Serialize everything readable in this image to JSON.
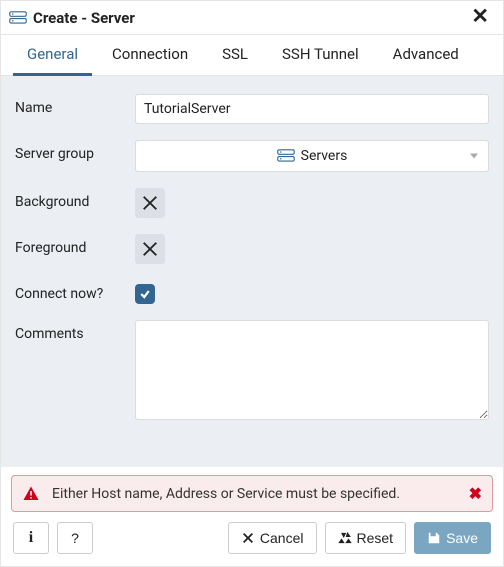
{
  "modal": {
    "title": "Create - Server"
  },
  "tabs": [
    {
      "label": "General",
      "active": true
    },
    {
      "label": "Connection",
      "active": false
    },
    {
      "label": "SSL",
      "active": false
    },
    {
      "label": "SSH Tunnel",
      "active": false
    },
    {
      "label": "Advanced",
      "active": false
    }
  ],
  "form": {
    "name": {
      "label": "Name",
      "value": "TutorialServer"
    },
    "server_group": {
      "label": "Server group",
      "selected": "Servers"
    },
    "background": {
      "label": "Background"
    },
    "foreground": {
      "label": "Foreground"
    },
    "connect_now": {
      "label": "Connect now?",
      "checked": true
    },
    "comments": {
      "label": "Comments",
      "value": ""
    }
  },
  "error": {
    "message": "Either Host name, Address or Service must be specified."
  },
  "footer": {
    "cancel": "Cancel",
    "reset": "Reset",
    "save": "Save",
    "help": "?"
  }
}
